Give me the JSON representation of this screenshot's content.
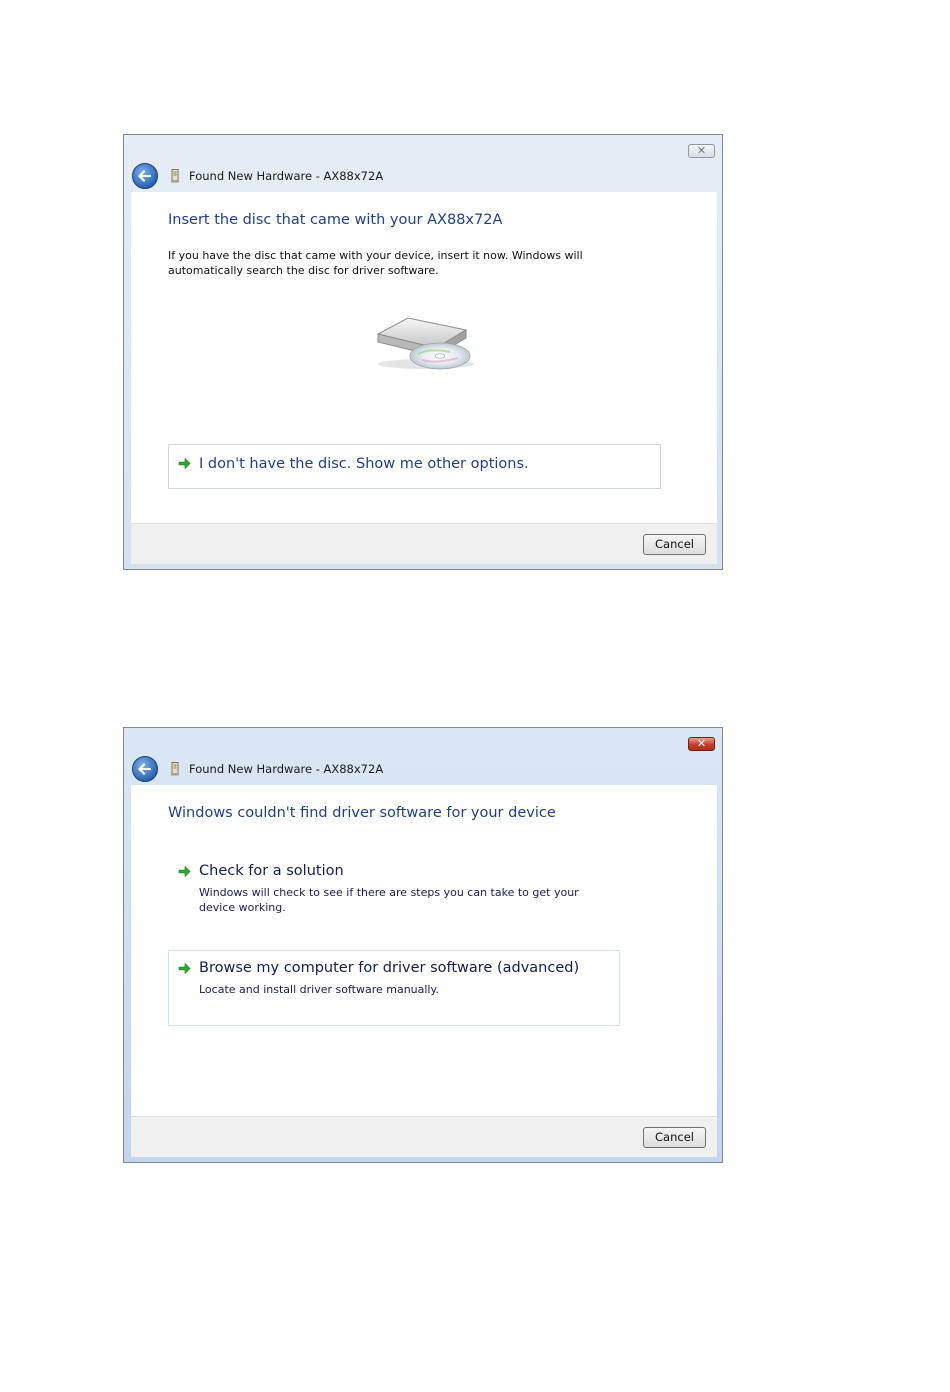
{
  "dialog1": {
    "window_title": "Found New Hardware - AX88x72A",
    "close_label": "✕",
    "heading": "Insert the disc that came with your AX88x72A",
    "body": "If you have the disc that came with your device, insert it now.  Windows will automatically search the disc for driver software.",
    "option_no_disc": "I don't have the disc.  Show me other options.",
    "cancel_label": "Cancel"
  },
  "dialog2": {
    "window_title": "Found New Hardware - AX88x72A",
    "close_label": "✕",
    "heading": "Windows couldn't find driver software for your device",
    "check_solution_title": "Check for a solution",
    "check_solution_desc": "Windows will check to see if there are steps you can take to get your device working.",
    "browse_title": "Browse my computer for driver software (advanced)",
    "browse_desc": "Locate and install driver software manually.",
    "cancel_label": "Cancel"
  },
  "colors": {
    "heading_blue": "#1e3f8c",
    "arrow_green": "#2ea82e",
    "close_red": "#c3402a"
  },
  "icons": [
    "back-arrow-icon",
    "hardware-icon",
    "disc-drive-icon",
    "green-arrow-icon",
    "close-icon"
  ]
}
